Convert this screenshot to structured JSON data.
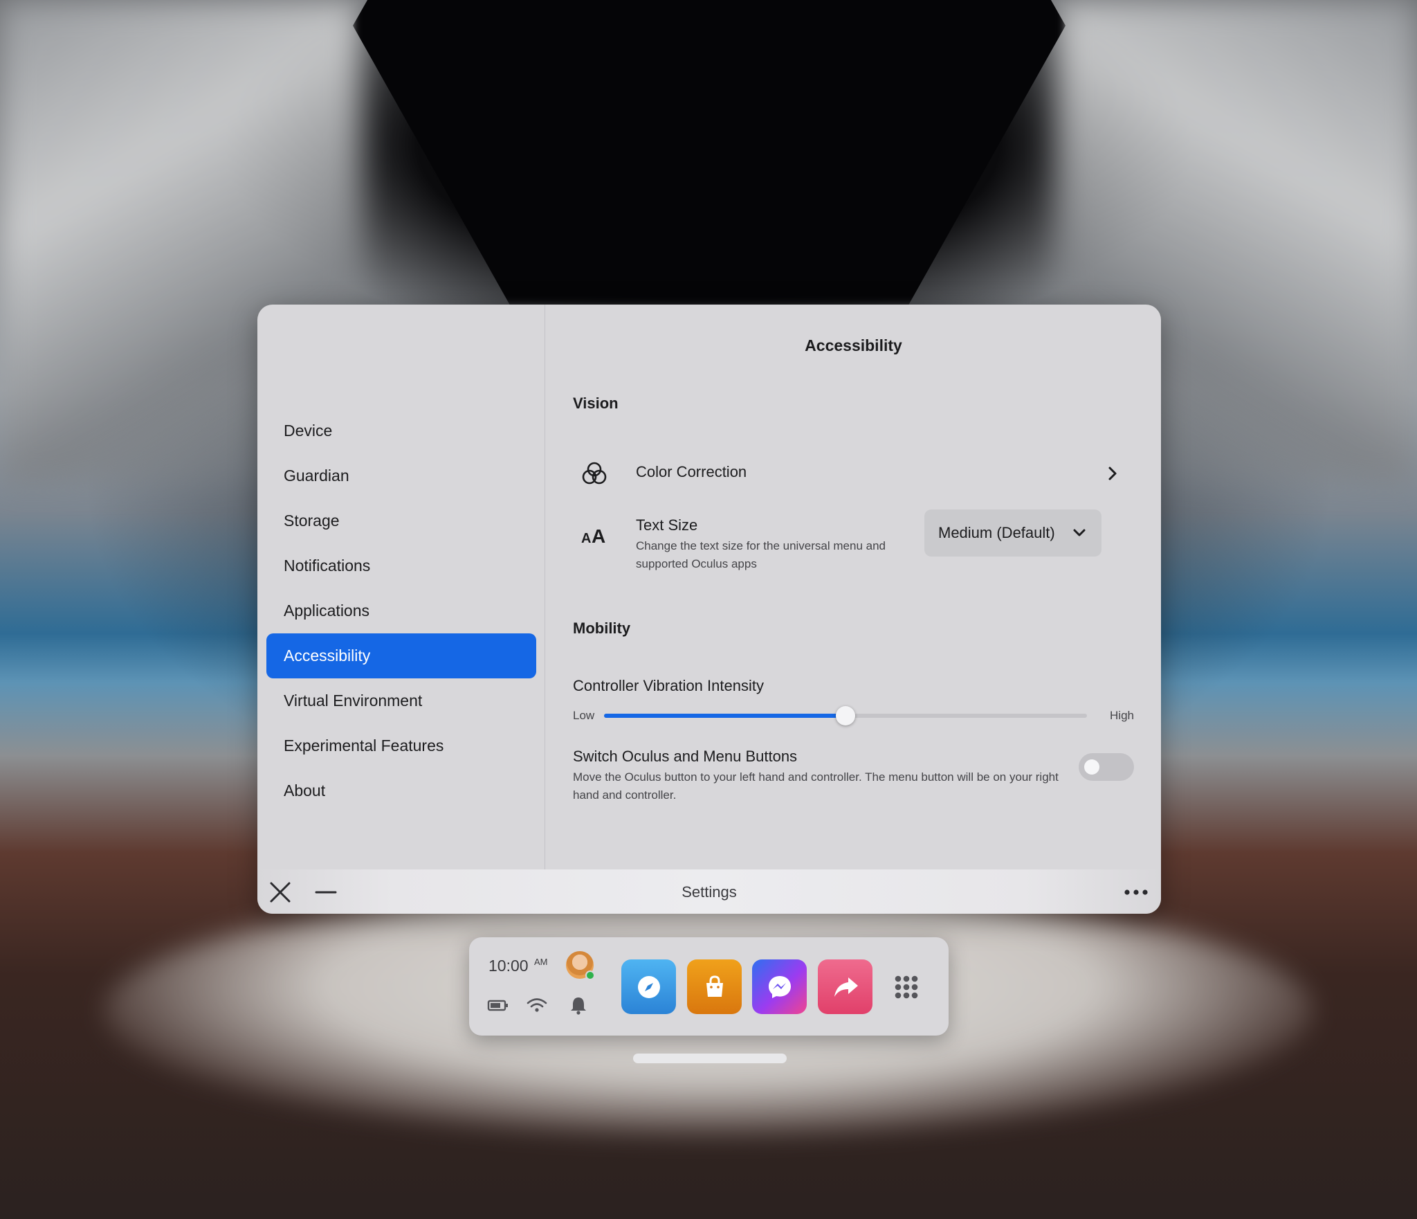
{
  "window": {
    "title": "Settings",
    "sidebar": {
      "items": [
        {
          "label": "Device"
        },
        {
          "label": "Guardian"
        },
        {
          "label": "Storage"
        },
        {
          "label": "Notifications"
        },
        {
          "label": "Applications"
        },
        {
          "label": "Accessibility",
          "active": true
        },
        {
          "label": "Virtual Environment"
        },
        {
          "label": "Experimental Features"
        },
        {
          "label": "About"
        }
      ]
    },
    "main": {
      "title": "Accessibility",
      "vision": {
        "title": "Vision",
        "color_correction": {
          "label": "Color Correction",
          "icon": "color-circles-icon"
        },
        "text_size": {
          "label": "Text Size",
          "description": "Change the text size for the universal menu and supported Oculus apps",
          "selected": "Medium (Default)",
          "icon": "text-size-icon"
        }
      },
      "mobility": {
        "title": "Mobility",
        "vibration": {
          "label": "Controller Vibration Intensity",
          "low": "Low",
          "high": "High",
          "value_percent": 50
        },
        "switch_buttons": {
          "label": "Switch Oculus and Menu Buttons",
          "description": "Move the Oculus button to your left hand and controller. The menu button will be on your right hand and controller.",
          "enabled": false
        }
      }
    }
  },
  "dock": {
    "time": "10:00",
    "ampm": "AM",
    "apps": [
      "explore-icon",
      "store-icon",
      "messenger-icon",
      "share-icon"
    ]
  },
  "colors": {
    "accent": "#1567e5",
    "panel": "#d8d7da"
  }
}
